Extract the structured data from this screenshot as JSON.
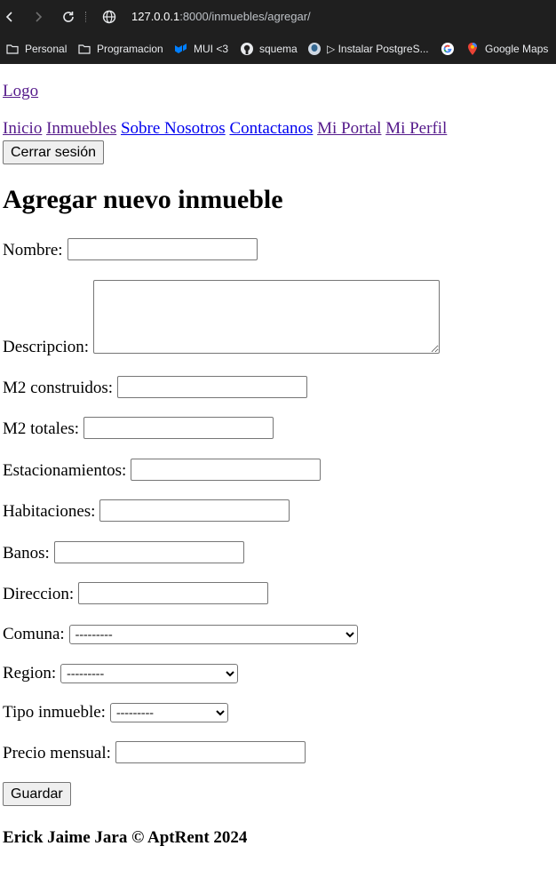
{
  "browser": {
    "url_host": "127.0.0.1",
    "url_path": ":8000/inmuebles/agregar/",
    "bookmarks": [
      {
        "label": "Personal",
        "icon": "folder-icon"
      },
      {
        "label": "Programacion",
        "icon": "folder-icon"
      },
      {
        "label": "MUI <3",
        "icon": "mui-icon"
      },
      {
        "label": "squema",
        "icon": "github-icon"
      },
      {
        "label": "▷ Instalar PostgreS...",
        "icon": "postgres-icon"
      },
      {
        "label": "",
        "icon": "google-icon"
      },
      {
        "label": "Google Maps",
        "icon": "maps-pin-icon"
      }
    ]
  },
  "header": {
    "logo": "Logo",
    "nav": [
      {
        "label": "Inicio"
      },
      {
        "label": "Inmuebles"
      },
      {
        "label": "Sobre Nosotros"
      },
      {
        "label": "Contactanos"
      },
      {
        "label": "Mi Portal"
      },
      {
        "label": "Mi Perfil"
      }
    ],
    "logout_label": "Cerrar sesión"
  },
  "form": {
    "title": "Agregar nuevo inmueble",
    "fields": {
      "nombre": {
        "label": "Nombre:",
        "value": ""
      },
      "descripcion": {
        "label": "Descripcion:",
        "value": ""
      },
      "m2_construidos": {
        "label": "M2 construidos:",
        "value": ""
      },
      "m2_totales": {
        "label": "M2 totales:",
        "value": ""
      },
      "estacionamientos": {
        "label": "Estacionamientos:",
        "value": ""
      },
      "habitaciones": {
        "label": "Habitaciones:",
        "value": ""
      },
      "banos": {
        "label": "Banos:",
        "value": ""
      },
      "direccion": {
        "label": "Direccion:",
        "value": ""
      },
      "comuna": {
        "label": "Comuna:",
        "selected": "---------"
      },
      "region": {
        "label": "Region:",
        "selected": "---------"
      },
      "tipo_inmueble": {
        "label": "Tipo inmueble:",
        "selected": "---------"
      },
      "precio_mensual": {
        "label": "Precio mensual:",
        "value": ""
      }
    },
    "save_label": "Guardar"
  },
  "footer": {
    "text": "Erick Jaime Jara © AptRent 2024"
  }
}
